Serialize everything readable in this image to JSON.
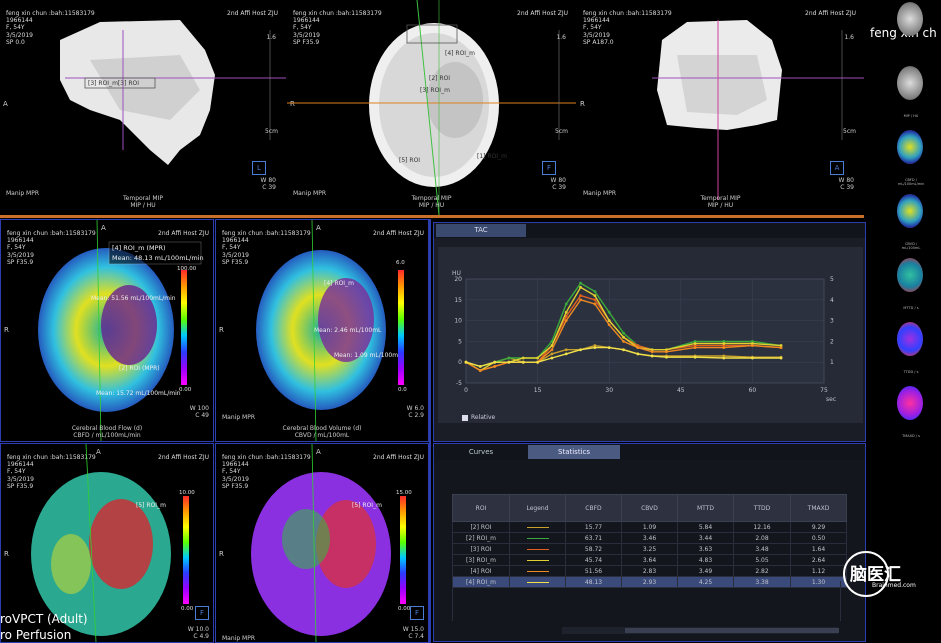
{
  "patient": {
    "name": "feng xin chun :bah:11583179",
    "id": "1966144",
    "sex_age": "F, 54Y",
    "date": "3/5/2019",
    "institution": "2nd Affi Host ZJU",
    "sidebar_name": "feng xin ch"
  },
  "top_viewports": [
    {
      "sp": "SP 0.0",
      "orient_left": "A",
      "corner": "L",
      "scale": "5cm",
      "w": "80",
      "c": "39",
      "manip": "Manip MPR",
      "title": "Temporal MIP",
      "unit": "MIP / HU",
      "roi": "[3] ROI_m[3] ROI",
      "zoom": "1.6"
    },
    {
      "sp": "SP F35.9",
      "orient_left": "R",
      "corner": "F",
      "scale": "5cm",
      "w": "80",
      "c": "39",
      "manip": "Manip MPR",
      "title": "Temporal MIP",
      "unit": "MIP / HU",
      "roi": "[4] ROI_m",
      "roi2": "[2] ROI",
      "roi3": "[3] ROI_m",
      "roi4": "[5] ROI",
      "roi5": "[1] ROI_m",
      "zoom": "1.6"
    },
    {
      "sp": "SP A187.0",
      "orient_left": "R",
      "corner": "A",
      "scale": "5cm",
      "w": "80",
      "c": "39",
      "manip": "Manip MPR",
      "title": "Temporal MIP",
      "unit": "MIP / HU",
      "zoom": "1.6"
    }
  ],
  "perfusion_viewports": [
    {
      "sp": "SP F35.9",
      "title": "Cerebral Blood Flow (d)",
      "unit": "CBFD / mL/100mL/min",
      "cb_max": "100.00",
      "cb_min": "0.00",
      "w": "100",
      "c": "49",
      "roi_label": "[4] ROI_m (MPR)",
      "roi_mean": "Mean: 48.13 mL/100mL/min",
      "roi_mean2": "Mean: 51.56 mL/100mL/min",
      "roi_lower": "[2] ROI (MPR)",
      "roi_lower2": "Mean: 15.72 mL/100mL/min",
      "manip": ""
    },
    {
      "sp": "SP F35.9",
      "title": "Cerebral Blood Volume (d)",
      "unit": "CBVD / mL/100mL",
      "cb_max": "6.0",
      "cb_min": "0.0",
      "w": "6.0",
      "c": "2.9",
      "roi_label": "[4] ROI_m",
      "roi_mean": "Mean: 2.46 mL/100mL",
      "roi_mean2": "Mean: 1.09 mL/100mL",
      "manip": "Manip MPR"
    },
    {
      "sp": "SP F35.9",
      "title": "",
      "unit": "",
      "cb_max": "10.00",
      "cb_min": "0.00",
      "w": "10.0",
      "c": "4.9",
      "roi_label": "[5] ROI_m",
      "roi_mean": "",
      "manip": "",
      "corner": "F"
    },
    {
      "sp": "SP F35.9",
      "title": "",
      "unit": "",
      "cb_max": "15.00",
      "cb_min": "0.00",
      "w": "15.0",
      "c": "7.4",
      "roi_label": "[5] ROI_m",
      "roi_mean": "",
      "manip": "Manip MPR",
      "corner": "F"
    }
  ],
  "tac": {
    "tab": "TAC",
    "relative_label": "Relative"
  },
  "chart_data": {
    "type": "line",
    "ylabel": "HU",
    "xlabel": "sec",
    "xlim": [
      0,
      75
    ],
    "ylim": [
      -5,
      20
    ],
    "y2lim": [
      0,
      5
    ],
    "x_ticks": [
      "0",
      "15",
      "30",
      "45",
      "60",
      "75"
    ],
    "y_ticks": [
      "20",
      "15",
      "10",
      "5",
      "0",
      "-5"
    ],
    "y2_ticks": [
      "5",
      "4",
      "3",
      "2",
      "1"
    ],
    "series": [
      {
        "name": "[2] ROI",
        "color": "#c8a02a",
        "x": [
          0,
          3,
          6,
          9,
          12,
          15,
          18,
          21,
          24,
          27,
          30,
          33,
          36,
          39,
          42,
          48,
          54,
          60,
          66
        ],
        "y": [
          0,
          -1,
          0,
          1,
          0,
          0,
          2,
          3,
          3,
          4,
          3.5,
          3,
          2,
          1.5,
          1.5,
          1.5,
          1.5,
          1.2,
          1.2
        ]
      },
      {
        "name": "[2] ROI_m",
        "color": "#3aaa3a",
        "x": [
          0,
          3,
          6,
          9,
          12,
          15,
          18,
          21,
          24,
          27,
          30,
          33,
          36,
          39,
          42,
          48,
          54,
          60,
          66
        ],
        "y": [
          0,
          -1,
          0,
          1,
          1,
          1,
          5,
          14,
          19,
          17,
          12,
          7,
          4,
          3,
          3,
          5,
          5,
          5,
          4
        ]
      },
      {
        "name": "[3] ROI",
        "color": "#e06020",
        "x": [
          0,
          3,
          6,
          9,
          12,
          15,
          18,
          21,
          24,
          27,
          30,
          33,
          36,
          39,
          42,
          48,
          54,
          60,
          66
        ],
        "y": [
          0,
          -2,
          -1,
          0,
          0,
          0,
          4,
          11,
          16,
          15,
          10,
          6,
          4,
          3,
          3,
          4,
          4,
          4,
          3.5
        ]
      },
      {
        "name": "[3] ROI_m",
        "color": "#e0d030",
        "x": [
          0,
          3,
          6,
          9,
          12,
          15,
          18,
          21,
          24,
          27,
          30,
          33,
          36,
          39,
          42,
          48,
          54,
          60,
          66
        ],
        "y": [
          0,
          -2,
          0,
          0,
          1,
          1,
          4,
          12,
          18,
          16,
          10,
          6,
          3.5,
          3,
          3,
          4.5,
          4.5,
          4.5,
          4
        ]
      },
      {
        "name": "[4] ROI",
        "color": "#f08a20",
        "x": [
          0,
          3,
          6,
          9,
          12,
          15,
          18,
          21,
          24,
          27,
          30,
          33,
          36,
          39,
          42,
          48,
          54,
          60,
          66
        ],
        "y": [
          0,
          -2,
          -1,
          0,
          0,
          0,
          3,
          10,
          15,
          14,
          9,
          5,
          3.5,
          2.5,
          2.5,
          3.5,
          3.5,
          4,
          3.5
        ]
      },
      {
        "name": "[4] ROI_m",
        "color": "#f0e04a",
        "x": [
          0,
          3,
          6,
          9,
          12,
          15,
          18,
          21,
          24,
          27,
          30,
          33,
          36,
          39,
          42,
          48,
          54,
          60,
          66
        ],
        "y": [
          0,
          -1,
          0,
          0,
          0,
          0,
          1,
          2,
          3,
          3.5,
          3.5,
          3,
          2,
          1.5,
          1.2,
          1.2,
          1,
          1,
          1
        ]
      }
    ]
  },
  "stats": {
    "tab_curves": "Curves",
    "tab_statistics": "Statistics",
    "headers": [
      "ROI",
      "Legend",
      "CBFD",
      "CBVD",
      "MTTD",
      "TTDD",
      "TMAXD"
    ],
    "rows": [
      {
        "roi": "[2] ROI",
        "color": "#c8a02a",
        "cbfd": "15.77",
        "cbvd": "1.09",
        "mttd": "5.84",
        "ttdd": "12.16",
        "tmaxd": "9.29"
      },
      {
        "roi": "[2] ROI_m",
        "color": "#3aaa3a",
        "cbfd": "63.71",
        "cbvd": "3.46",
        "mttd": "3.44",
        "ttdd": "2.08",
        "tmaxd": "0.50"
      },
      {
        "roi": "[3] ROI",
        "color": "#e06020",
        "cbfd": "58.72",
        "cbvd": "3.25",
        "mttd": "3.63",
        "ttdd": "3.48",
        "tmaxd": "1.64"
      },
      {
        "roi": "[3] ROI_m",
        "color": "#e0d030",
        "cbfd": "45.74",
        "cbvd": "3.64",
        "mttd": "4.83",
        "ttdd": "5.05",
        "tmaxd": "2.64"
      },
      {
        "roi": "[4] ROI",
        "color": "#f08a20",
        "cbfd": "51.56",
        "cbvd": "2.83",
        "mttd": "3.49",
        "ttdd": "2.82",
        "tmaxd": "1.12"
      },
      {
        "roi": "[4] ROI_m",
        "color": "#f0e04a",
        "cbfd": "48.13",
        "cbvd": "2.93",
        "mttd": "4.25",
        "ttdd": "3.38",
        "tmaxd": "1.30"
      }
    ]
  },
  "sidebar_thumbs": [
    {
      "label": "",
      "colors": "gray"
    },
    {
      "label": "MIP / HU",
      "colors": "gray"
    },
    {
      "label": "CBFD / mL/100mL/min",
      "colors": "map1"
    },
    {
      "label": "CBVD / mL/100mL",
      "colors": "map1"
    },
    {
      "label": "MTTD / s",
      "colors": "map2"
    },
    {
      "label": "TTDD / s",
      "colors": "map3"
    },
    {
      "label": "TMAXD / s",
      "colors": "map4"
    }
  ],
  "app_title_line1": "roVPCT (Adult)",
  "app_title_line2": "ro Perfusion",
  "logo_text": "脑医汇",
  "logo_sub": "Brainmed.com"
}
